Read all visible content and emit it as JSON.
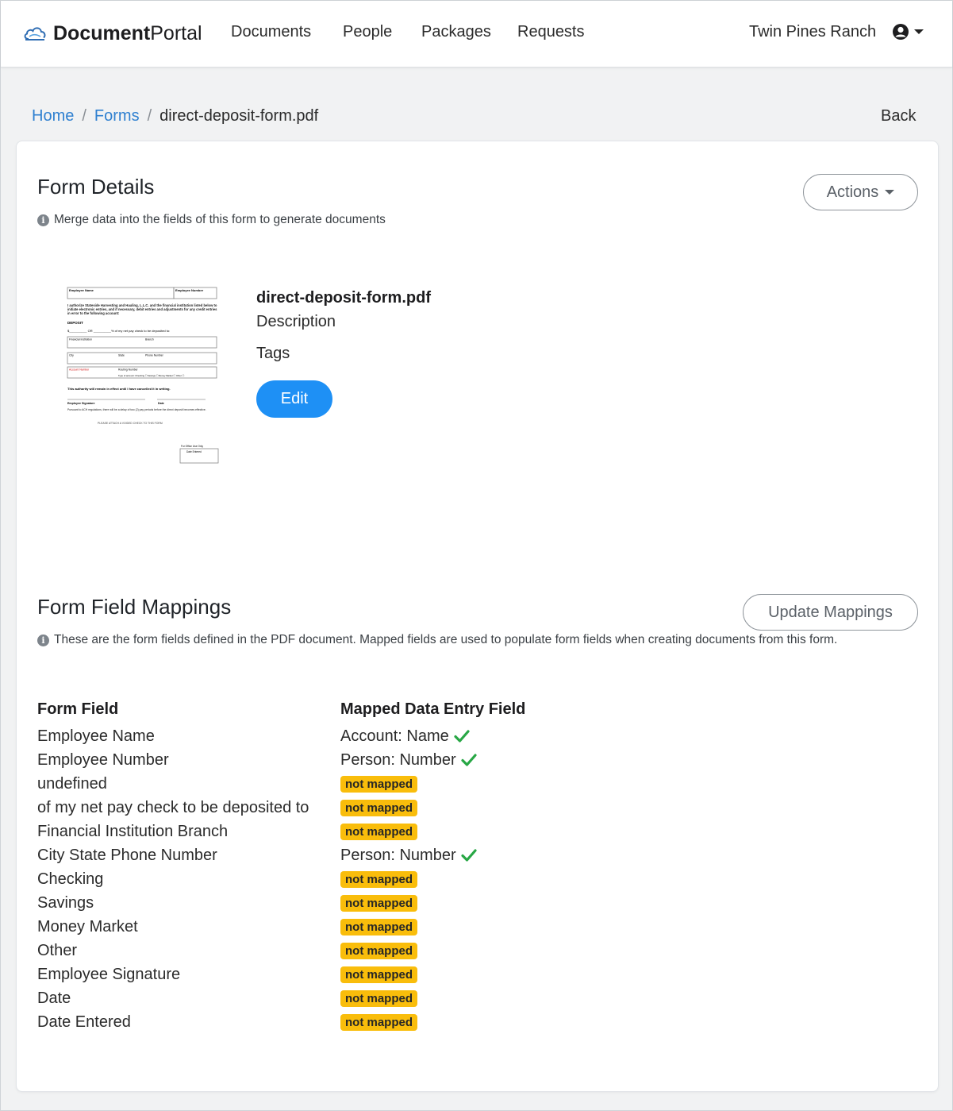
{
  "navbar": {
    "brand_bold": "Document",
    "brand_rest": "Portal",
    "links": [
      "Documents",
      "People",
      "Packages",
      "Requests"
    ],
    "account_name": "Twin Pines Ranch"
  },
  "breadcrumb": {
    "home": "Home",
    "forms": "Forms",
    "current": "direct-deposit-form.pdf",
    "back": "Back"
  },
  "form_details": {
    "title": "Form Details",
    "info": "Merge data into the fields of this form to generate documents",
    "actions_label": "Actions",
    "file_name": "direct-deposit-form.pdf",
    "description_label": "Description",
    "tags_label": "Tags",
    "edit_label": "Edit"
  },
  "thumbnail": {
    "employee_name": "Employee Name",
    "employee_number": "Employee Number",
    "authorize_text": "I authorize Stateside Harvesting and Hauling, L.L.C. and the financial institution listed below to initiate electronic entries, and if necessary, debit entries and adjustments for any credit entries in error to the following account:",
    "deposit": "DEPOSIT",
    "deposit_line": "$__________ OR __________% of my net pay check to be deposited to:",
    "financial_institution": "Financial Institution",
    "branch": "Branch",
    "city": "City",
    "state": "State",
    "phone_number": "Phone Number",
    "account_number": "Account Number",
    "routing_number": "Routing Number",
    "type_of_account": "Type of account:  Checking ☐  Savings ☐  Money Market ☐  Other ☐",
    "authority_text": "This authority will remain in effect until I have cancelled it in writing.",
    "employee_signature": "Employee Signature",
    "date": "Date",
    "ach_text": "Pursuant to ACH regulations, there will be a delay of two (2) pay periods before the direct deposit becomes effective.",
    "attach_text": "PLEASE ATTACH A VOIDED CHECK TO THIS FORM",
    "office_use": "For Office Use Only",
    "date_entered": "Date Entered"
  },
  "mappings": {
    "title": "Form Field Mappings",
    "update_label": "Update Mappings",
    "info": "These are the form fields defined in the PDF document. Mapped fields are used to populate form fields when creating documents from this form.",
    "col_form_field": "Form Field",
    "col_mapped": "Mapped Data Entry Field",
    "not_mapped_label": "not mapped",
    "rows": [
      {
        "field": "Employee Name",
        "mapped": "Account: Name"
      },
      {
        "field": "Employee Number",
        "mapped": "Person: Number"
      },
      {
        "field": "undefined",
        "mapped": null
      },
      {
        "field": "of my net pay check to be deposited to",
        "mapped": null
      },
      {
        "field": "Financial Institution Branch",
        "mapped": null
      },
      {
        "field": "City State Phone Number",
        "mapped": "Person: Number"
      },
      {
        "field": "Checking",
        "mapped": null
      },
      {
        "field": "Savings",
        "mapped": null
      },
      {
        "field": "Money Market",
        "mapped": null
      },
      {
        "field": "Other",
        "mapped": null
      },
      {
        "field": "Employee Signature",
        "mapped": null
      },
      {
        "field": "Date",
        "mapped": null
      },
      {
        "field": "Date Entered",
        "mapped": null
      }
    ]
  },
  "colors": {
    "primary": "#1e90f5",
    "link": "#2f80d0",
    "badge": "#f9bd0b",
    "check": "#28a745"
  }
}
